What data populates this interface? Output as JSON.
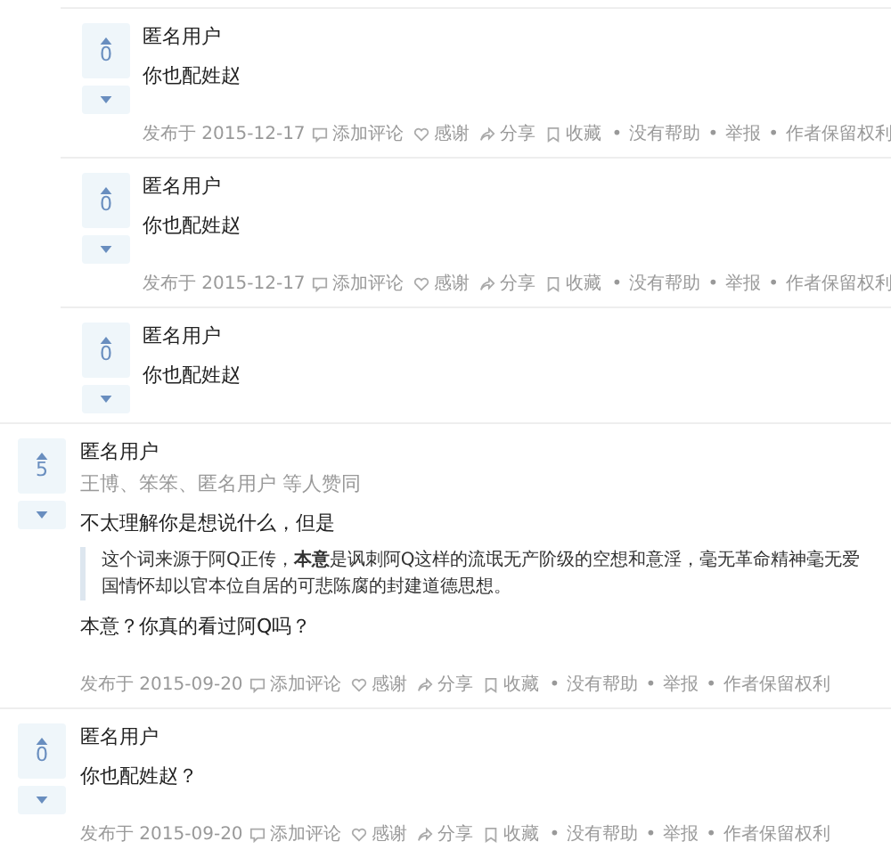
{
  "answers": [
    {
      "kind": "nested",
      "votes": "0",
      "author": "匿名用户",
      "paragraphs": [
        "你也配姓赵"
      ],
      "footer": {
        "date": "发布于 2015-12-17",
        "actions": [
          {
            "kind": "comment",
            "label": "添加评论"
          },
          {
            "kind": "thanks",
            "label": "感谢"
          },
          {
            "kind": "share",
            "label": "分享"
          },
          {
            "kind": "collect",
            "label": "收藏"
          },
          {
            "kind": "dot",
            "label": "•"
          },
          {
            "kind": "text",
            "label": "没有帮助"
          },
          {
            "kind": "dot",
            "label": "•"
          },
          {
            "kind": "text",
            "label": "举报"
          },
          {
            "kind": "dot",
            "label": "•"
          },
          {
            "kind": "text",
            "label": "作者保留权利"
          }
        ]
      }
    },
    {
      "kind": "nested",
      "votes": "0",
      "author": "匿名用户",
      "paragraphs": [
        "你也配姓赵"
      ],
      "footer": {
        "date": "发布于 2015-12-17",
        "actions": [
          {
            "kind": "comment",
            "label": "添加评论"
          },
          {
            "kind": "thanks",
            "label": "感谢"
          },
          {
            "kind": "share",
            "label": "分享"
          },
          {
            "kind": "collect",
            "label": "收藏"
          },
          {
            "kind": "dot",
            "label": "•"
          },
          {
            "kind": "text",
            "label": "没有帮助"
          },
          {
            "kind": "dot",
            "label": "•"
          },
          {
            "kind": "text",
            "label": "举报"
          },
          {
            "kind": "dot",
            "label": "•"
          },
          {
            "kind": "text",
            "label": "作者保留权利"
          }
        ]
      }
    },
    {
      "kind": "nested",
      "votes": "0",
      "author": "匿名用户",
      "paragraphs": [
        "你也配姓赵"
      ]
    },
    {
      "kind": "top",
      "votes": "5",
      "author": "匿名用户",
      "voters": "王博、笨笨、匿名用户 等人赞同",
      "paragraphs": [
        "不太理解你是想说什么，但是"
      ],
      "quote": "这个词来源于阿Q正传，**本意**是讽刺阿Q这样的流氓无产阶级的空想和意淫，毫无革命精神毫无爱国情怀却以官本位自居的可悲陈腐的封建道德思想。",
      "after": "本意？你真的看过阿Q吗？",
      "footer": {
        "date": "发布于 2015-09-20",
        "actions": [
          {
            "kind": "comment",
            "label": "添加评论"
          },
          {
            "kind": "thanks",
            "label": "感谢"
          },
          {
            "kind": "share",
            "label": "分享"
          },
          {
            "kind": "collect",
            "label": "收藏"
          },
          {
            "kind": "dot",
            "label": "•"
          },
          {
            "kind": "text",
            "label": "没有帮助"
          },
          {
            "kind": "dot",
            "label": "•"
          },
          {
            "kind": "text",
            "label": "举报"
          },
          {
            "kind": "dot",
            "label": "•"
          },
          {
            "kind": "text",
            "label": "作者保留权利"
          }
        ]
      }
    },
    {
      "kind": "top",
      "votes": "0",
      "author": "匿名用户",
      "paragraphs": [
        "你也配姓赵？"
      ],
      "footer": {
        "date": "发布于 2015-09-20",
        "actions": [
          {
            "kind": "comment",
            "label": "添加评论"
          },
          {
            "kind": "thanks",
            "label": "感谢"
          },
          {
            "kind": "share",
            "label": "分享"
          },
          {
            "kind": "collect",
            "label": "收藏"
          },
          {
            "kind": "dot",
            "label": "•"
          },
          {
            "kind": "text",
            "label": "没有帮助"
          },
          {
            "kind": "dot",
            "label": "•"
          },
          {
            "kind": "text",
            "label": "举报"
          },
          {
            "kind": "dot",
            "label": "•"
          },
          {
            "kind": "text",
            "label": "作者保留权利"
          }
        ]
      }
    }
  ]
}
